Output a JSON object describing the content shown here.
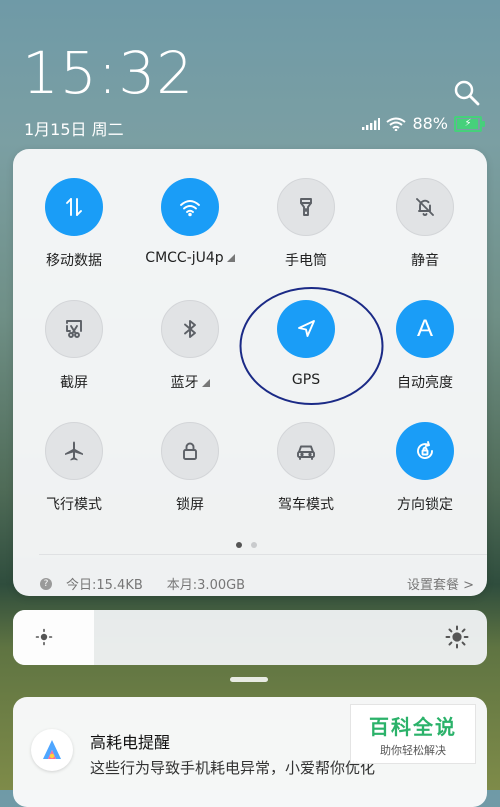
{
  "status": {
    "time": "15:32",
    "date": "1月15日 周二",
    "battery": "88%",
    "battery_level": 0.88,
    "icons": [
      "signal-icon",
      "wifi-icon",
      "battery-charging-icon"
    ]
  },
  "search": {
    "icon": "search-icon"
  },
  "tiles": [
    {
      "label": "移动数据",
      "icon": "data-arrows-icon",
      "state": "on"
    },
    {
      "label": "CMCC-jU4p",
      "icon": "wifi-icon",
      "state": "on",
      "more": true
    },
    {
      "label": "手电筒",
      "icon": "flashlight-icon",
      "state": "off"
    },
    {
      "label": "静音",
      "icon": "bell-off-icon",
      "state": "off"
    },
    {
      "label": "截屏",
      "icon": "screenshot-icon",
      "state": "off"
    },
    {
      "label": "蓝牙",
      "icon": "bluetooth-icon",
      "state": "off",
      "more": true
    },
    {
      "label": "GPS",
      "icon": "location-arrow-icon",
      "state": "on"
    },
    {
      "label": "自动亮度",
      "icon": "auto-brightness-icon",
      "state": "on"
    },
    {
      "label": "飞行模式",
      "icon": "airplane-icon",
      "state": "off"
    },
    {
      "label": "锁屏",
      "icon": "lock-icon",
      "state": "off"
    },
    {
      "label": "驾车模式",
      "icon": "car-icon",
      "state": "off"
    },
    {
      "label": "方向锁定",
      "icon": "rotation-lock-icon",
      "state": "on"
    }
  ],
  "pager": {
    "pages": 2,
    "current": 1
  },
  "usage": {
    "today": "今日:15.4KB",
    "month": "本月:3.00GB",
    "setting": "设置套餐 >"
  },
  "brightness": {
    "level": 0.17
  },
  "notification": {
    "title": "高耗电提醒",
    "body": "这些行为导致手机耗电异常，小爱帮你优化"
  },
  "watermark": {
    "title": "百科全说",
    "subtitle": "助你轻松解决"
  },
  "colors": {
    "accent": "#1a9df7",
    "annotation": "#1b2a86",
    "battery": "#46d07b"
  }
}
